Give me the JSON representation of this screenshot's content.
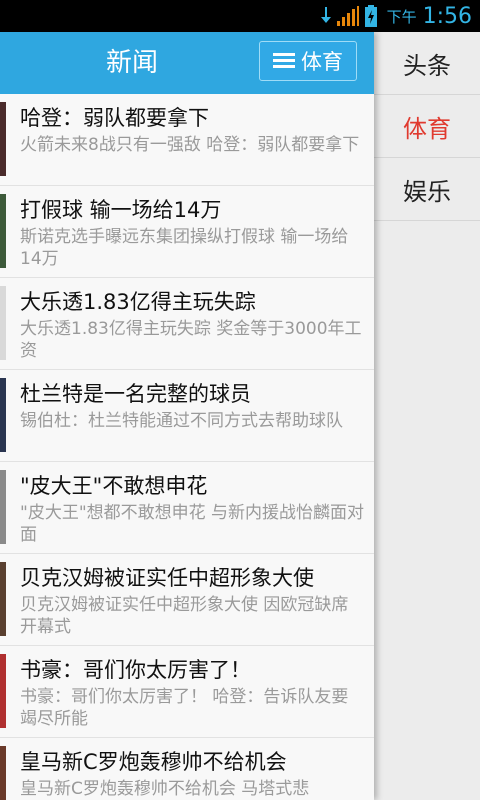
{
  "status_bar": {
    "ampm": "下午",
    "time": "1:56"
  },
  "action_bar": {
    "title": "新闻",
    "category_button": "体育"
  },
  "drawer": {
    "items": [
      {
        "label": "头条",
        "active": false
      },
      {
        "label": "体育",
        "active": true
      },
      {
        "label": "娱乐",
        "active": false
      }
    ]
  },
  "news": [
    {
      "title": "哈登：弱队都要拿下",
      "desc": "火箭未来8战只有一强敌 哈登：弱队都要拿下",
      "thumb_color": "#4a2b2b"
    },
    {
      "title": "打假球 输一场给14万",
      "desc": "斯诺克选手曝远东集团操纵打假球 输一场给14万",
      "thumb_color": "#3d5a3a"
    },
    {
      "title": "大乐透1.83亿得主玩失踪",
      "desc": "大乐透1.83亿得主玩失踪 奖金等于3000年工资",
      "thumb_color": "#d9d9d9"
    },
    {
      "title": "杜兰特是一名完整的球员",
      "desc": "锡伯杜：杜兰特能通过不同方式去帮助球队",
      "thumb_color": "#2a3550"
    },
    {
      "title": "\"皮大王\"不敢想申花",
      "desc": "\"皮大王\"想都不敢想申花 与新内援战怡麟面对面",
      "thumb_color": "#8a8a8a"
    },
    {
      "title": "贝克汉姆被证实任中超形象大使",
      "desc": "贝克汉姆被证实任中超形象大使 因欧冠缺席开幕式",
      "thumb_color": "#5a4030"
    },
    {
      "title": "书豪：哥们你太厉害了！",
      "desc": "书豪：哥们你太厉害了！ 哈登：告诉队友要竭尽所能",
      "thumb_color": "#b03030"
    },
    {
      "title": "皇马新C罗炮轰穆帅不给机会",
      "desc": "皇马新C罗炮轰穆帅不给机会 马塔式悲",
      "thumb_color": "#6a3a2a"
    }
  ]
}
